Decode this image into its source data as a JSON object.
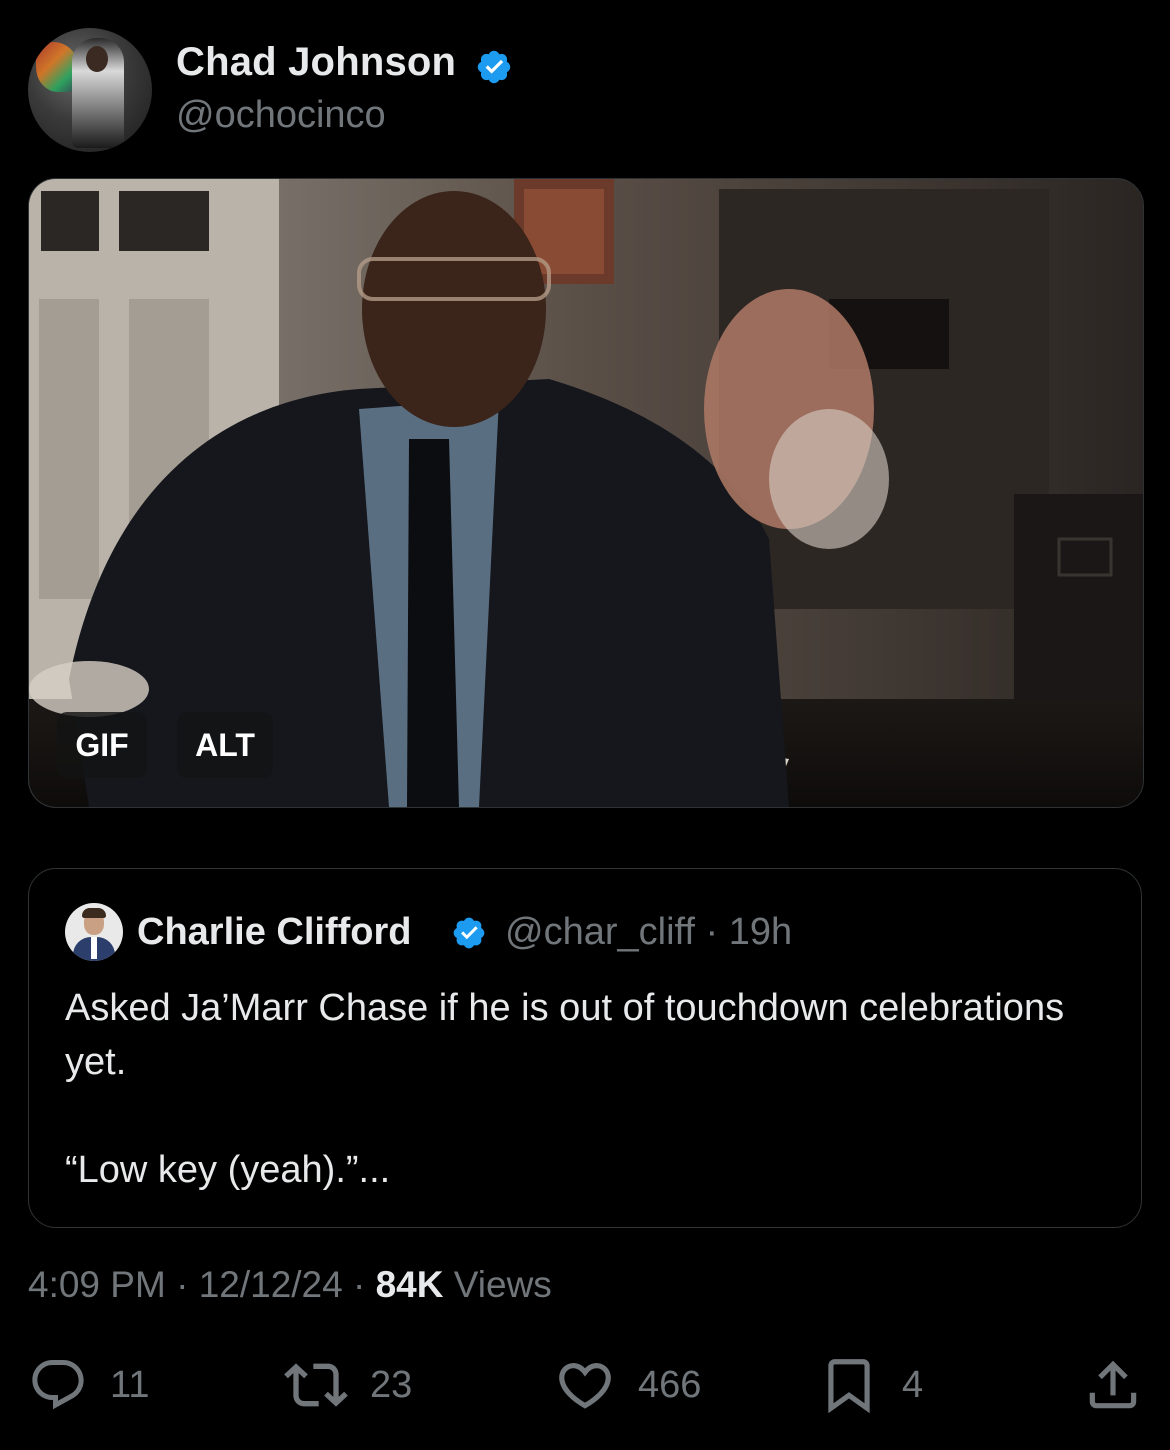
{
  "post": {
    "author_name": "Chad Johnson",
    "author_handle": "@ochocinco",
    "verified": true,
    "media": {
      "badges": [
        "GIF",
        "ALT"
      ]
    },
    "timestamp": "4:09 PM",
    "date": "12/12/24",
    "views_count": "84K",
    "views_label": "Views",
    "separator": "·"
  },
  "quoted_post": {
    "author_name": "Charlie Clifford",
    "author_handle": "@char_cliff",
    "age": "19h",
    "verified": true,
    "text_line1": "Asked Ja’Marr Chase if he is out of touchdown celebrations yet.",
    "text_line2": "“Low key (yeah).”..."
  },
  "actions": {
    "replies": "11",
    "reposts": "23",
    "likes": "466",
    "bookmarks": "4"
  },
  "colors": {
    "background": "#000000",
    "text_primary": "#e7e9ea",
    "text_secondary": "#71767b",
    "verified_blue": "#1d9bf0",
    "border": "#2f3336"
  },
  "icons": [
    "verified-badge-icon",
    "reply-icon",
    "repost-icon",
    "like-icon",
    "bookmark-icon",
    "share-icon"
  ]
}
